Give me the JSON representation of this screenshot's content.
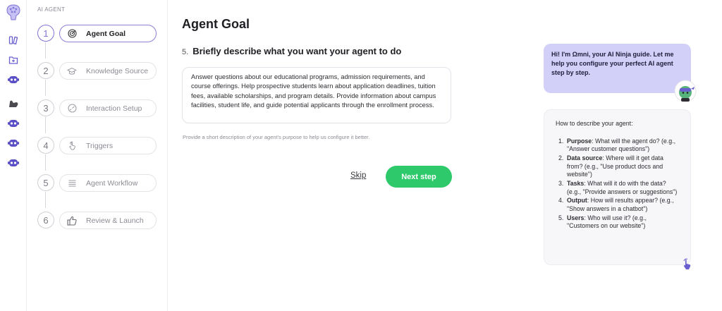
{
  "colors": {
    "accent": "#7f75d6",
    "primary_button": "#2ec96b",
    "guide_bubble": "#d2cff8"
  },
  "rail": {
    "icons": [
      "brain-logo-icon",
      "library-icon",
      "add-folder-icon",
      "robot-icon",
      "arm-icon",
      "robot-icon",
      "robot-icon",
      "robot-icon"
    ]
  },
  "steps": {
    "section_label": "AI AGENT",
    "items": [
      {
        "num": "1",
        "label": "Agent Goal",
        "icon": "target-icon",
        "active": true
      },
      {
        "num": "2",
        "label": "Knowledge Source",
        "icon": "graduation-cap-icon",
        "active": false
      },
      {
        "num": "3",
        "label": "Interaction Setup",
        "icon": "gauge-icon",
        "active": false
      },
      {
        "num": "4",
        "label": "Triggers",
        "icon": "tap-icon",
        "active": false
      },
      {
        "num": "5",
        "label": "Agent Workflow",
        "icon": "list-icon",
        "active": false
      },
      {
        "num": "6",
        "label": "Review & Launch",
        "icon": "thumbs-up-icon",
        "active": false
      }
    ]
  },
  "main": {
    "title": "Agent Goal",
    "question_num": "5.",
    "question_text": "Briefly describe what you want your agent to do",
    "goal_text": "Answer questions about our educational programs, admission requirements, and course offerings. Help prospective students learn about application deadlines, tuition fees, available scholarships, and program details. Provide information about campus facilities, student life, and guide potential applicants through the enrollment process.",
    "helper": "Provide a short description of your agent's purpose to help us configure it better.",
    "skip_label": "Skip",
    "next_label": "Next step"
  },
  "guide": {
    "bubble_text": "Hi! I'm Ωmni, your AI Ninja guide. Let me help you configure your perfect AI agent step by step.",
    "tips_heading": "How to describe your agent:",
    "tips": [
      {
        "n": "1.",
        "term": "Purpose",
        "text": ": What will the agent do? (e.g., \"Answer customer questions\")"
      },
      {
        "n": "2.",
        "term": "Data source",
        "text": ": Where will it get data from? (e.g., \"Use product docs and website\")"
      },
      {
        "n": "3.",
        "term": "Tasks",
        "text": ": What will it do with the data? (e.g., \"Provide answers or suggestions\")"
      },
      {
        "n": "4.",
        "term": "Output",
        "text": ": How will results appear? (e.g., \"Show answers in a chatbot\")"
      },
      {
        "n": "5.",
        "term": "Users",
        "text": ": Who will use it? (e.g., \"Customers on our website\")"
      }
    ]
  }
}
